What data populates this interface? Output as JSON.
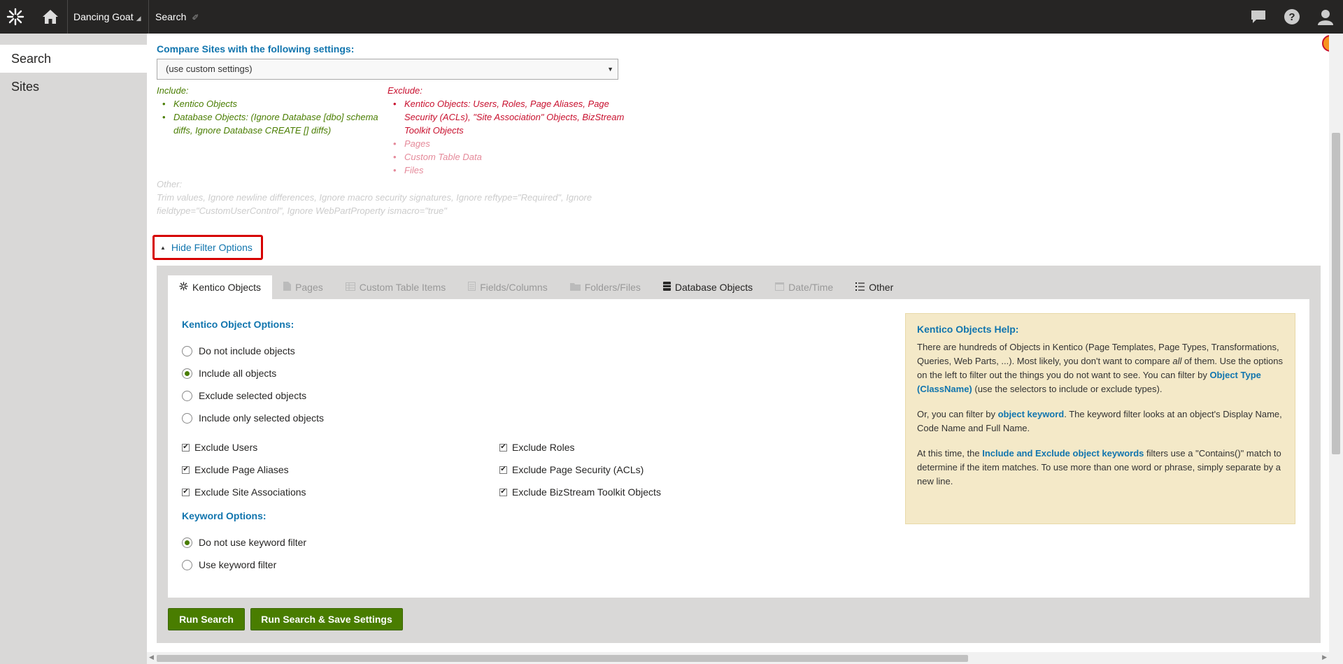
{
  "topbar": {
    "site_name": "Dancing Goat",
    "app_name": "Search",
    "icons": [
      "kentico-logo-icon",
      "home-icon",
      "pin-icon",
      "chat-icon",
      "help-icon",
      "user-icon"
    ]
  },
  "sidebar": {
    "items": [
      {
        "label": "Search"
      },
      {
        "label": "Sites"
      }
    ]
  },
  "compare": {
    "label": "Compare Sites with the following settings:",
    "selected": "(use custom settings)"
  },
  "include": {
    "title": "Include:",
    "items": [
      "Kentico Objects",
      "Database Objects: (Ignore Database [dbo] schema diffs, Ignore Database CREATE [] diffs)"
    ]
  },
  "exclude": {
    "title": "Exclude:",
    "items": [
      "Kentico Objects: Users, Roles, Page Aliases, Page Security (ACLs), \"Site Association\" Objects, BizStream Toolkit Objects",
      "Pages",
      "Custom Table Data",
      "Files"
    ]
  },
  "other": {
    "title": "Other:",
    "text": "Trim values, Ignore newline differences, Ignore macro security signatures, Ignore reftype=\"Required\", Ignore fieldtype=\"CustomUserControl\", Ignore WebPartProperty ismacro=\"true\""
  },
  "filter_toggle": {
    "label": "Hide Filter Options"
  },
  "tabs": [
    {
      "label": "Kentico Objects",
      "icon": "kentico-icon"
    },
    {
      "label": "Pages",
      "icon": "page-icon"
    },
    {
      "label": "Custom Table Items",
      "icon": "table-icon"
    },
    {
      "label": "Fields/Columns",
      "icon": "columns-icon"
    },
    {
      "label": "Folders/Files",
      "icon": "folder-icon"
    },
    {
      "label": "Database Objects",
      "icon": "database-icon"
    },
    {
      "label": "Date/Time",
      "icon": "calendar-icon"
    },
    {
      "label": "Other",
      "icon": "list-icon"
    }
  ],
  "object_options": {
    "heading": "Kentico Object Options:",
    "radios": [
      {
        "label": "Do not include objects",
        "checked": false
      },
      {
        "label": "Include all objects",
        "checked": true
      },
      {
        "label": "Exclude selected objects",
        "checked": false
      },
      {
        "label": "Include only selected objects",
        "checked": false
      }
    ],
    "checkboxes": [
      {
        "label": "Exclude Users",
        "checked": true
      },
      {
        "label": "Exclude Roles",
        "checked": true
      },
      {
        "label": "Exclude Page Aliases",
        "checked": true
      },
      {
        "label": "Exclude Page Security (ACLs)",
        "checked": true
      },
      {
        "label": "Exclude Site Associations",
        "checked": true
      },
      {
        "label": "Exclude BizStream Toolkit Objects",
        "checked": true
      }
    ]
  },
  "keyword_options": {
    "heading": "Keyword Options:",
    "radios": [
      {
        "label": "Do not use keyword filter",
        "checked": true
      },
      {
        "label": "Use keyword filter",
        "checked": false
      }
    ]
  },
  "help": {
    "title": "Kentico Objects Help:",
    "p1a": "There are hundreds of Objects in Kentico (Page Templates, Page Types, Transformations, Queries, Web Parts, ...). Most likely, you don't want to compare ",
    "p1_em": "all",
    "p1b": " of them. Use the options on the left to filter out the things you do not want to see. You can filter by ",
    "p1_link": "Object Type (ClassName)",
    "p1c": " (use the selectors to include or exclude types).",
    "p2a": "Or, you can filter by ",
    "p2_link": "object keyword",
    "p2b": ". The keyword filter looks at an object's Display Name, Code Name and Full Name.",
    "p3a": "At this time, the ",
    "p3_link": "Include and Exclude object keywords",
    "p3b": " filters use a \"Contains()\" match to determine if the item matches. To use more than one word or phrase, simply separate by a new line."
  },
  "buttons": {
    "run": "Run Search",
    "run_save": "Run Search & Save Settings"
  },
  "colors": {
    "topbar": "#262524",
    "accent_blue": "#1175ae",
    "include_green": "#497d00",
    "exclude_red": "#c8102e",
    "button_green": "#497d00"
  }
}
